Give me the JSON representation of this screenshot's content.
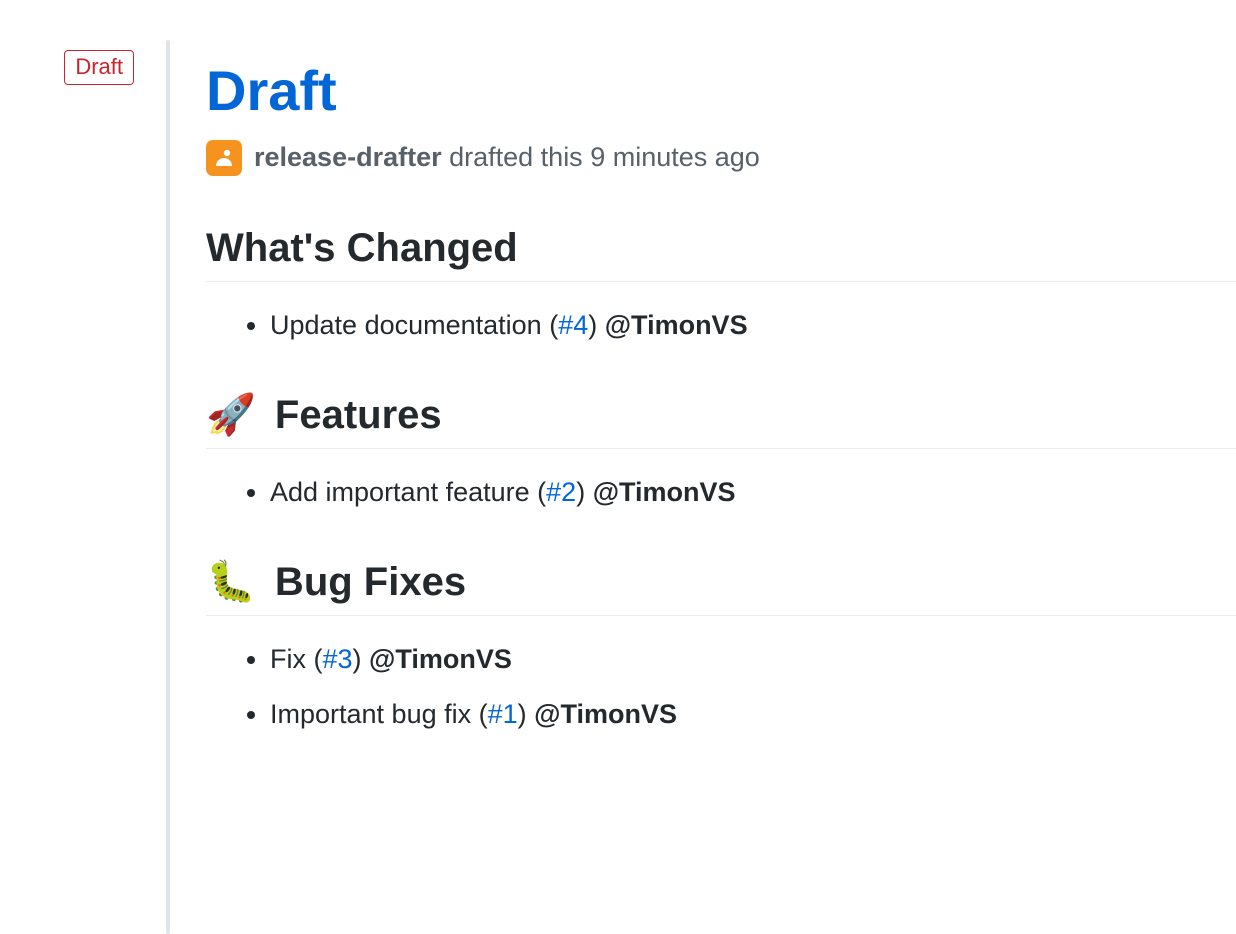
{
  "sidebar": {
    "badge": "Draft"
  },
  "release": {
    "title": "Draft",
    "actor": "release-drafter",
    "action_text": " drafted this 9 minutes ago"
  },
  "sections": {
    "whats_changed": {
      "heading": "What's Changed",
      "items": [
        {
          "pre": "Update documentation (",
          "pr": "#4",
          "post": ") ",
          "mention": "@TimonVS"
        }
      ]
    },
    "features": {
      "emoji": "🚀",
      "heading": " Features",
      "items": [
        {
          "pre": "Add important feature (",
          "pr": "#2",
          "post": ") ",
          "mention": "@TimonVS"
        }
      ]
    },
    "bugfixes": {
      "emoji": "🐛",
      "heading": " Bug Fixes",
      "items": [
        {
          "pre": "Fix (",
          "pr": "#3",
          "post": ") ",
          "mention": "@TimonVS"
        },
        {
          "pre": "Important bug fix (",
          "pr": "#1",
          "post": ") ",
          "mention": "@TimonVS"
        }
      ]
    }
  }
}
